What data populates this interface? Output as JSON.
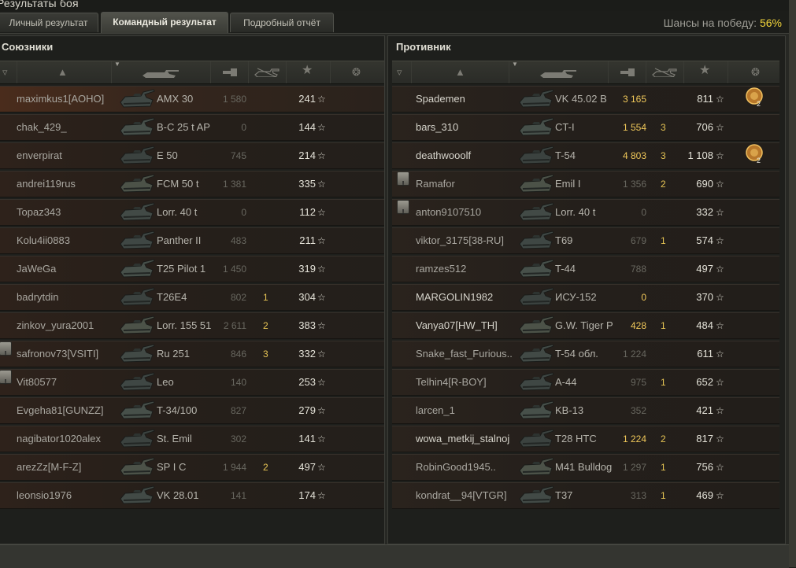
{
  "window": {
    "title": "Результаты боя"
  },
  "tabs": [
    {
      "label": "Личный результат"
    },
    {
      "label": "Командный результат"
    },
    {
      "label": "Подробный отчёт"
    }
  ],
  "chances": {
    "label": "Шансы на победу:",
    "value": "56%"
  },
  "allies": {
    "title": "Союзники",
    "players": [
      {
        "name": "maximkus1[AOHO]",
        "vehicle": "AMX 30",
        "damage": "1 580",
        "kills": "",
        "xp": "241",
        "self": true
      },
      {
        "name": "chak_429_",
        "vehicle": "B-C 25 t AP",
        "damage": "0",
        "kills": "",
        "xp": "144"
      },
      {
        "name": "enverpirat",
        "vehicle": "E 50",
        "damage": "745",
        "kills": "",
        "xp": "214"
      },
      {
        "name": "andrei119rus",
        "vehicle": "FCM 50 t",
        "damage": "1 381",
        "kills": "",
        "xp": "335"
      },
      {
        "name": "Topaz343",
        "vehicle": "Lorr. 40 t",
        "damage": "0",
        "kills": "",
        "xp": "112"
      },
      {
        "name": "Kolu4ii0883",
        "vehicle": "Panther II",
        "damage": "483",
        "kills": "",
        "xp": "211"
      },
      {
        "name": "JaWeGa",
        "vehicle": "T25 Pilot 1",
        "damage": "1 450",
        "kills": "",
        "xp": "319"
      },
      {
        "name": "badrytdin",
        "vehicle": "T26E4",
        "damage": "802",
        "kills": "1",
        "xp": "304"
      },
      {
        "name": "zinkov_yura2001",
        "vehicle": "Lorr. 155 51",
        "damage": "2 611",
        "kills": "2",
        "xp": "383"
      },
      {
        "name": "safronov73[VSITI]",
        "vehicle": "Ru 251",
        "damage": "846",
        "kills": "3",
        "xp": "332",
        "platoon": true
      },
      {
        "name": "Vit80577",
        "vehicle": "Leo",
        "damage": "140",
        "kills": "",
        "xp": "253",
        "platoon": true
      },
      {
        "name": "Evgeha81[GUNZZ]",
        "vehicle": "T-34/100",
        "damage": "827",
        "kills": "",
        "xp": "279"
      },
      {
        "name": "nagibator1020alex",
        "vehicle": "St. Emil",
        "damage": "302",
        "kills": "",
        "xp": "141"
      },
      {
        "name": "arezZz[M-F-Z]",
        "vehicle": "SP I C",
        "damage": "1 944",
        "kills": "2",
        "xp": "497"
      },
      {
        "name": "leonsio1976",
        "vehicle": "VK 28.01",
        "damage": "141",
        "kills": "",
        "xp": "174"
      }
    ]
  },
  "enemies": {
    "title": "Противник",
    "players": [
      {
        "name": "Spademen",
        "vehicle": "VK 45.02 B",
        "damage": "3 165",
        "kills": "",
        "xp": "811",
        "alive": true,
        "hl": true,
        "medal": "2"
      },
      {
        "name": "bars_310",
        "vehicle": "CT-I",
        "damage": "1 554",
        "kills": "3",
        "xp": "706",
        "alive": true,
        "hl": true
      },
      {
        "name": "deathwooolf",
        "vehicle": "T-54",
        "damage": "4 803",
        "kills": "3",
        "xp": "1 108",
        "alive": true,
        "hl": true,
        "medal": "2"
      },
      {
        "name": "Ramafor",
        "vehicle": "Emil I",
        "damage": "1 356",
        "kills": "2",
        "xp": "690",
        "platoon": true
      },
      {
        "name": "anton9107510",
        "vehicle": "Lorr. 40 t",
        "damage": "0",
        "kills": "",
        "xp": "332",
        "platoon": true
      },
      {
        "name": "viktor_3175[38-RU]",
        "vehicle": "T69",
        "damage": "679",
        "kills": "1",
        "xp": "574"
      },
      {
        "name": "ramzes512",
        "vehicle": "T-44",
        "damage": "788",
        "kills": "",
        "xp": "497"
      },
      {
        "name": "MARGOLIN1982",
        "vehicle": "ИСУ-152",
        "damage": "0",
        "kills": "",
        "xp": "370",
        "alive": true,
        "hl": true
      },
      {
        "name": "Vanya07[HW_TH]",
        "vehicle": "G.W. Tiger P",
        "damage": "428",
        "kills": "1",
        "xp": "484",
        "alive": true,
        "hl": true
      },
      {
        "name": "Snake_fast_Furious..",
        "vehicle": "T-54 обл.",
        "damage": "1 224",
        "kills": "",
        "xp": "611"
      },
      {
        "name": "Telhin4[R-BOY]",
        "vehicle": "A-44",
        "damage": "975",
        "kills": "1",
        "xp": "652"
      },
      {
        "name": "larcen_1",
        "vehicle": "KB-13",
        "damage": "352",
        "kills": "",
        "xp": "421"
      },
      {
        "name": "wowa_metkij_stalnoj",
        "vehicle": "T28 HTC",
        "damage": "1 224",
        "kills": "2",
        "xp": "817",
        "alive": true,
        "hl": true
      },
      {
        "name": "RobinGood1945..",
        "vehicle": "M41 Bulldog",
        "damage": "1 297",
        "kills": "1",
        "xp": "756"
      },
      {
        "name": "kondrat__94[VTGR]",
        "vehicle": "T37",
        "damage": "313",
        "kills": "1",
        "xp": "469"
      }
    ]
  },
  "icons": {
    "platoon": "shield-icon",
    "player": "player-icon",
    "vehicle": "tank-icon",
    "damage": "damage-icon",
    "kills": "destroyed-tank-icon",
    "xp": "star-icon",
    "medals": "medal-icon"
  },
  "colors": {
    "highlight": "#f0c85a",
    "chance": "#f2d53b"
  }
}
